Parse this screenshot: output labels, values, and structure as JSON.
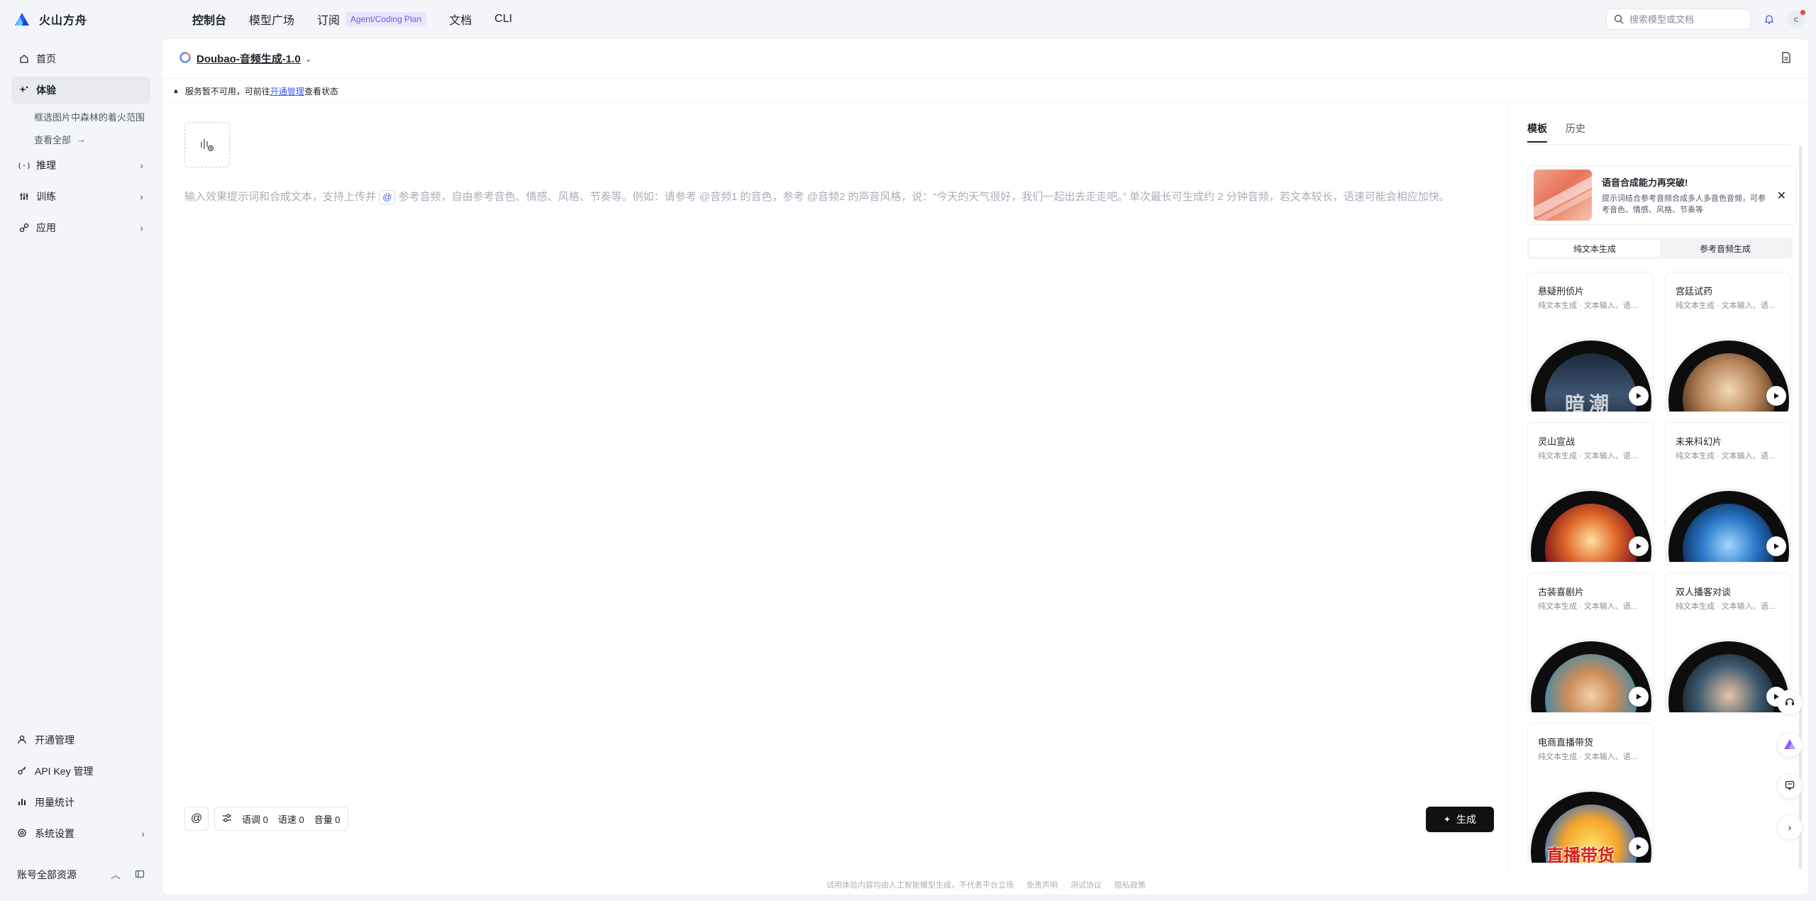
{
  "app": {
    "logo_text": "火山方舟"
  },
  "topnav": [
    {
      "label": "控制台",
      "active": true
    },
    {
      "label": "模型广场"
    },
    {
      "label": "订阅",
      "badge": "Agent/Coding Plan"
    },
    {
      "label": "文档"
    },
    {
      "label": "CLI"
    }
  ],
  "search": {
    "placeholder": "搜索模型或文档"
  },
  "user": {
    "avatar_letter": "c"
  },
  "sidebar": {
    "items": [
      {
        "label": "首页",
        "icon": "home-icon"
      },
      {
        "label": "体验",
        "icon": "sparkle-icon",
        "active": true
      },
      {
        "label": "推理",
        "icon": "code-icon"
      },
      {
        "label": "训练",
        "icon": "sliders-icon"
      },
      {
        "label": "应用",
        "icon": "link-icon"
      }
    ],
    "sub_recent": "框选图片中森林的着火范围",
    "sub_view_all": "查看全部",
    "bottom": [
      {
        "label": "开通管理",
        "icon": "user-icon"
      },
      {
        "label": "API Key 管理",
        "icon": "key-icon"
      },
      {
        "label": "用量统计",
        "icon": "chart-icon"
      },
      {
        "label": "系统设置",
        "icon": "settings-icon"
      }
    ],
    "account_label": "账号全部资源"
  },
  "main": {
    "model_name": "Doubao-音频生成-1.0",
    "notice_prefix": "服务暂不可用，可前往",
    "notice_link": "开通管理",
    "notice_suffix": "查看状态",
    "prompt_part1": "输入效果提示词和合成文本，支持上传并",
    "prompt_at": "@",
    "prompt_part2": "参考音频，自由参考音色、情感、风格、节奏等。例如：请参考 @音频1 的音色，参考 @音频2 的声音风格，说：“今天的天气很好，我们一起出去走走吧。” 单次最长可生成约 2 分钟音频，若文本较长，语速可能会相应加快。",
    "toolbar": {
      "at_label": "@",
      "pitch": "语调 0",
      "speed": "语速 0",
      "volume": "音量 0"
    },
    "generate_label": "生成"
  },
  "panel": {
    "tabs": [
      "模板",
      "历史"
    ],
    "promo_title": "语音合成能力再突破!",
    "promo_desc": "提示词结合参考音频合成多人多音色音频，可参考音色、情感、风格、节奏等",
    "seg": [
      "纯文本生成",
      "参考音频生成"
    ],
    "cards": [
      {
        "title": "悬疑刑侦片",
        "sub": "纯文本生成 · 文本输入、语..."
      },
      {
        "title": "宫廷试药",
        "sub": "纯文本生成 · 文本输入、语..."
      },
      {
        "title": "灵山宣战",
        "sub": "纯文本生成 · 文本输入、语..."
      },
      {
        "title": "未来科幻片",
        "sub": "纯文本生成 · 文本输入、语..."
      },
      {
        "title": "古装喜剧片",
        "sub": "纯文本生成 · 文本输入、语..."
      },
      {
        "title": "双人播客对谈",
        "sub": "纯文本生成 · 文本输入、语..."
      },
      {
        "title": "电商直播带货",
        "sub": "纯文本生成 · 文本输入、语..."
      }
    ],
    "disc_text_1": "暗潮",
    "disc_text_7": "直播带货"
  },
  "footer": [
    "试用体验内容均由人工智能模型生成，不代表平台立场",
    "免责声明",
    "测试协议",
    "隐私政策"
  ],
  "colors": {
    "accent": "#3a5bff",
    "badge_bg": "#e8e6fb",
    "badge_text": "#6c5ce7",
    "generate_bg": "#111111"
  }
}
